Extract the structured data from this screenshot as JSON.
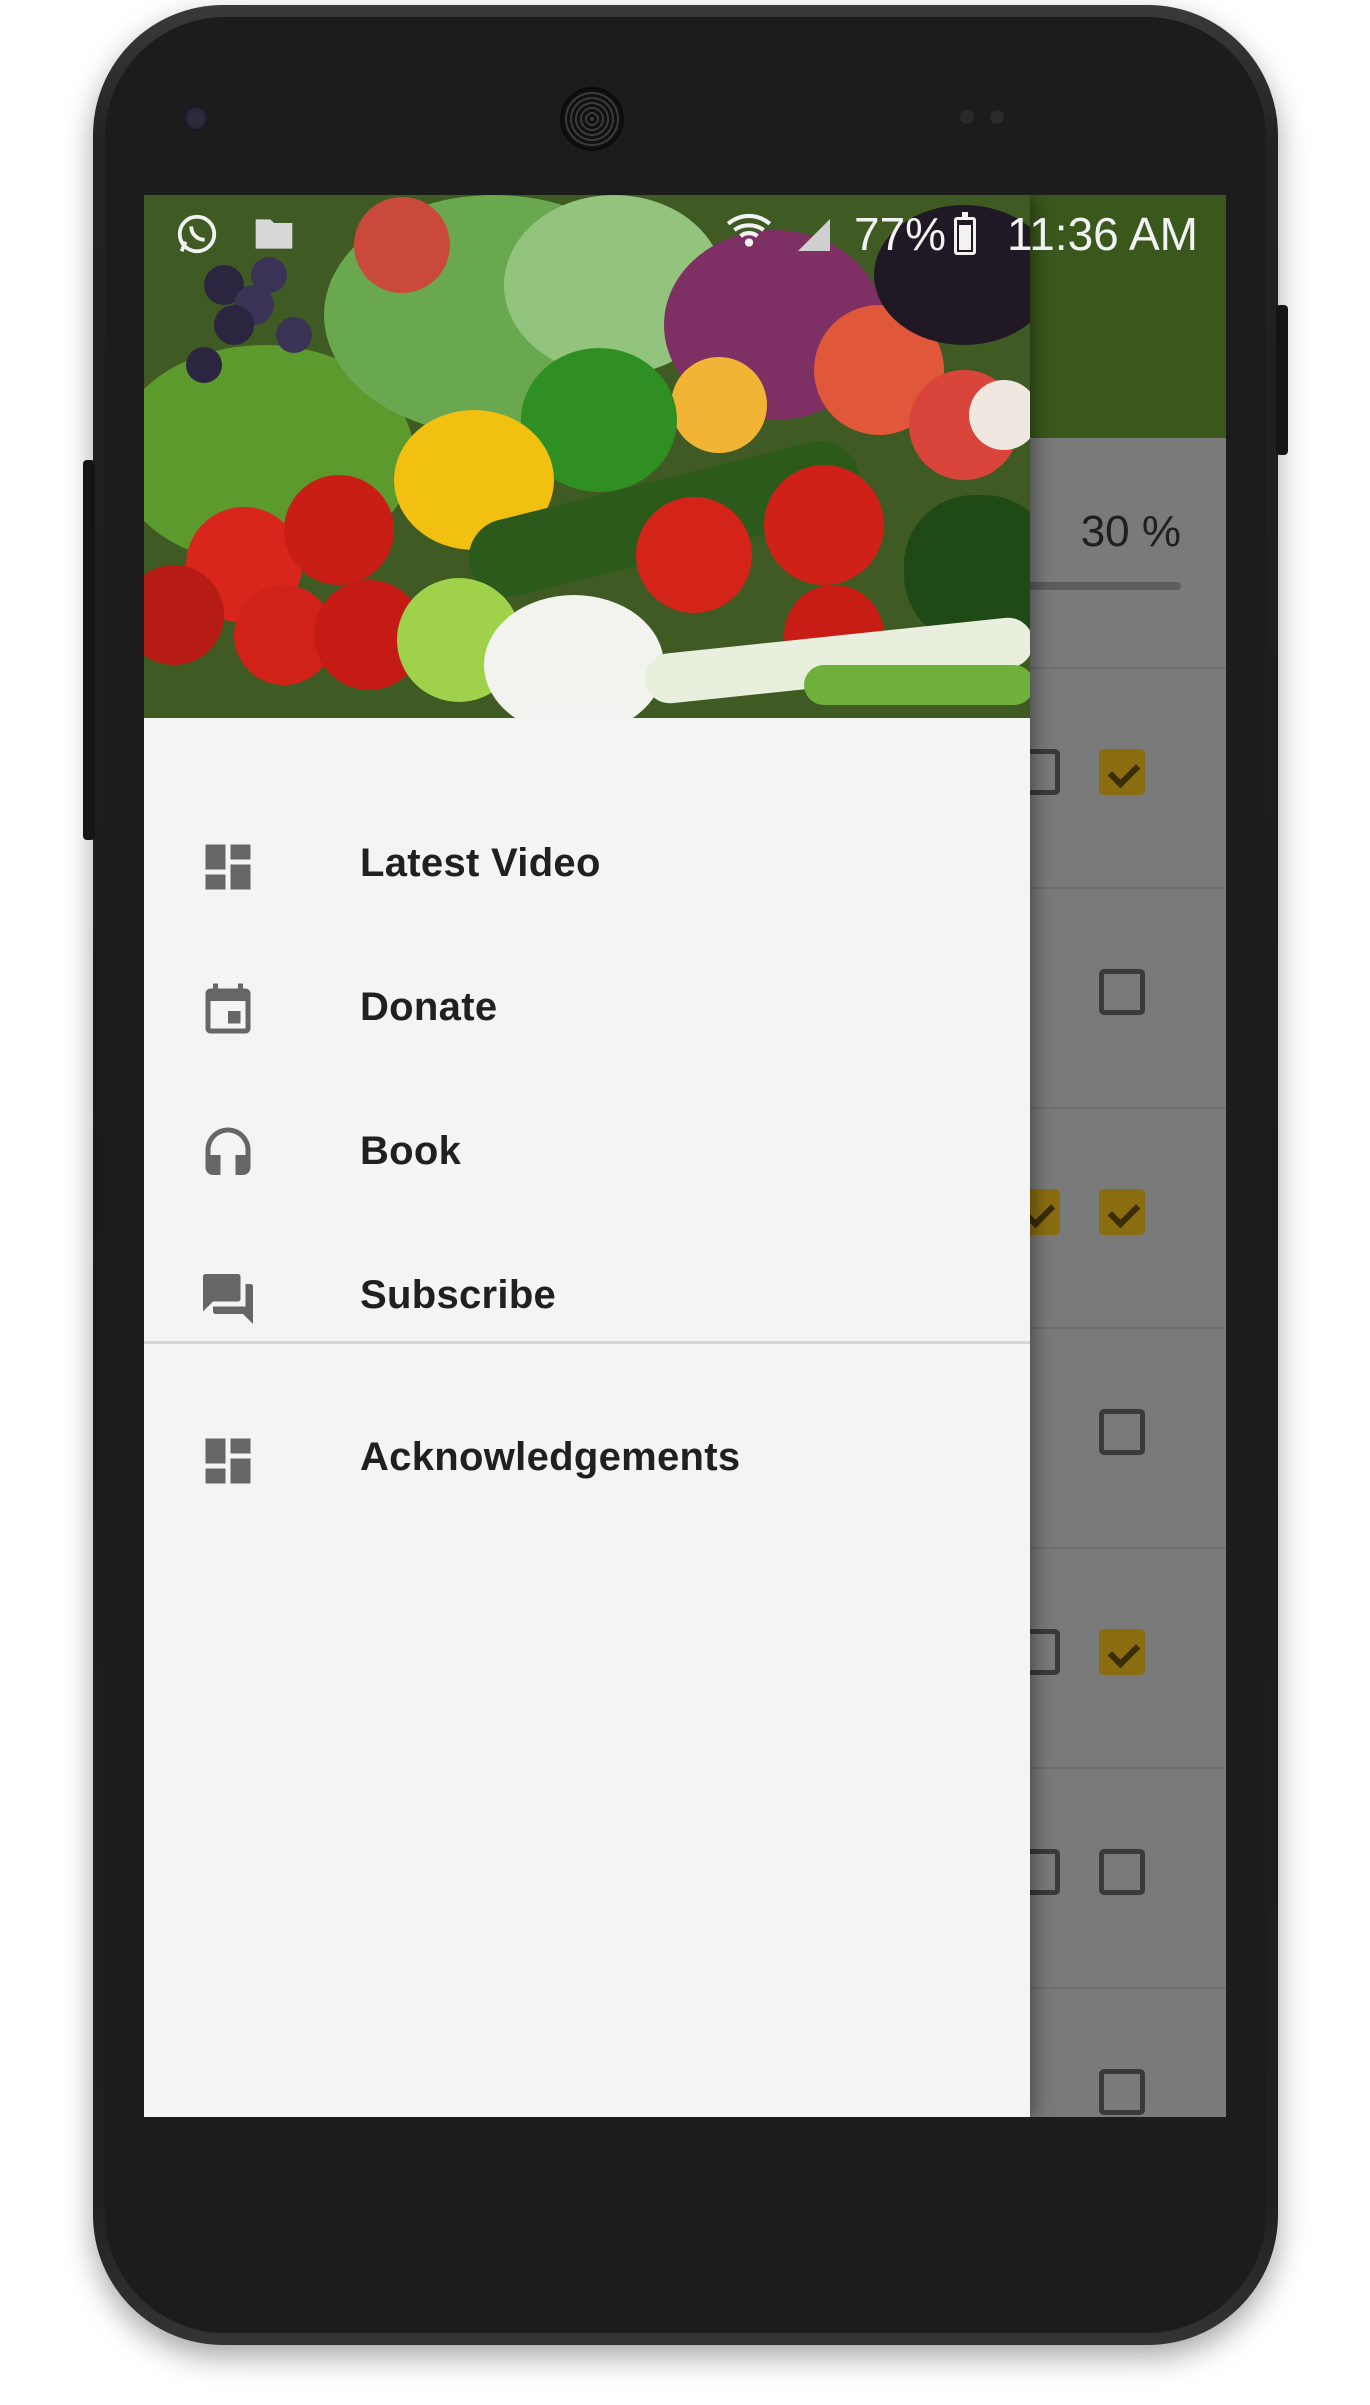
{
  "status_bar": {
    "battery_percent": "77%",
    "time": "11:36 AM",
    "icons": [
      "whatsapp-icon",
      "folder-icon",
      "wifi-icon",
      "signal-icon",
      "battery-charging-icon"
    ]
  },
  "background_app": {
    "toolbar_color": "#3a581c",
    "progress_text": "30 %",
    "progress": 0.3,
    "checkbox_color": "#8a6d10",
    "rows": [
      {
        "checkbox_a": false,
        "checkbox_b": true
      },
      {
        "checkbox_a": null,
        "checkbox_b": false
      },
      {
        "checkbox_a": true,
        "checkbox_b": true
      },
      {
        "checkbox_a": null,
        "checkbox_b": false
      },
      {
        "checkbox_a": false,
        "checkbox_b": true
      },
      {
        "checkbox_a": false,
        "checkbox_b": false
      },
      {
        "checkbox_a": null,
        "checkbox_b": false
      }
    ]
  },
  "drawer": {
    "header_image": "vegetables-header-image",
    "items": [
      {
        "label": "Latest Video",
        "icon": "dashboard-icon"
      },
      {
        "label": "Donate",
        "icon": "calendar-icon"
      },
      {
        "label": "Book",
        "icon": "headphones-icon"
      },
      {
        "label": "Subscribe",
        "icon": "forum-icon"
      }
    ],
    "secondary_items": [
      {
        "label": "Acknowledgements",
        "icon": "dashboard-icon"
      }
    ]
  }
}
